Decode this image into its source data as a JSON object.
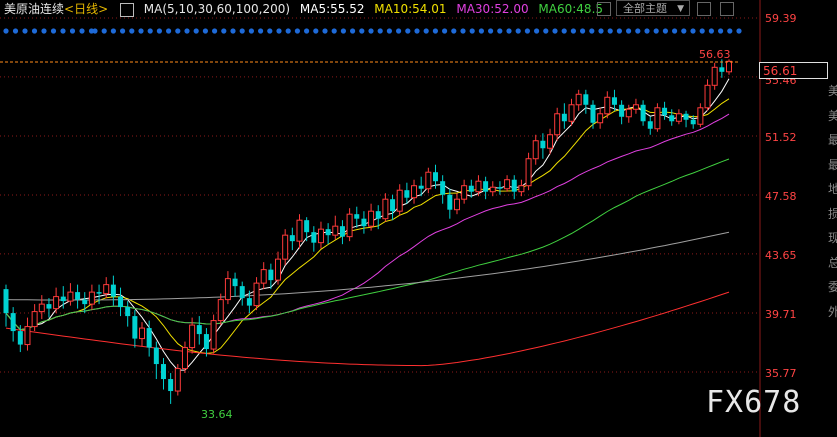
{
  "header": {
    "title": "美原油连续",
    "period": "<日线>",
    "ma_label": "MA(5,10,30,60,100,200)",
    "ma5": "MA5:55.52",
    "ma10": "MA10:54.01",
    "ma30": "MA30:52.00",
    "ma60": "MA60:48.5",
    "theme_button": "全部主题"
  },
  "price_tag": "56.61",
  "side_chars": [
    "美",
    "美",
    "最",
    "最",
    "地",
    "损",
    "现",
    "总",
    "委",
    "外"
  ],
  "watermark": "FX678",
  "colors": {
    "up": "#ff3b3b",
    "down": "#00d2d2",
    "ma5": "#ffffff",
    "ma10": "#f0e000",
    "ma30": "#e040e0",
    "ma60": "#40d040",
    "ma100": "#a0a0a0",
    "ma200": "#ff3030",
    "grid": "#8b1a1a",
    "dots": "#1e6ad8"
  },
  "chart_data": {
    "type": "candlestick",
    "y_ticks": [
      "59.39",
      "55.46",
      "51.52",
      "47.58",
      "43.65",
      "39.71",
      "35.77"
    ],
    "ylim": [
      35.77,
      59.39
    ],
    "annotations": {
      "high": "56.63",
      "low": "33.64"
    },
    "candles": [
      [
        41.3,
        39.7,
        41.6,
        38.8
      ],
      [
        39.7,
        38.5,
        40.1,
        37.8
      ],
      [
        38.5,
        37.6,
        38.9,
        37.1
      ],
      [
        37.6,
        38.8,
        39.4,
        37.2
      ],
      [
        38.8,
        39.8,
        40.3,
        38.5
      ],
      [
        39.8,
        40.3,
        40.9,
        39.3
      ],
      [
        40.3,
        40.0,
        40.7,
        39.4
      ],
      [
        40.0,
        40.8,
        41.4,
        39.7
      ],
      [
        40.8,
        40.5,
        41.5,
        40.0
      ],
      [
        40.5,
        41.1,
        41.7,
        40.2
      ],
      [
        41.1,
        40.6,
        41.6,
        40.0
      ],
      [
        40.6,
        40.3,
        41.1,
        39.7
      ],
      [
        40.3,
        41.1,
        41.6,
        39.9
      ],
      [
        41.1,
        41.0,
        41.6,
        40.3
      ],
      [
        41.0,
        41.6,
        42.1,
        40.7
      ],
      [
        41.6,
        40.8,
        42.2,
        40.2
      ],
      [
        40.8,
        40.1,
        41.4,
        39.5
      ],
      [
        40.1,
        39.5,
        40.5,
        38.8
      ],
      [
        39.5,
        38.0,
        39.9,
        37.4
      ],
      [
        38.0,
        38.7,
        39.1,
        37.5
      ],
      [
        38.7,
        37.4,
        39.2,
        36.8
      ],
      [
        37.4,
        36.3,
        37.8,
        35.3
      ],
      [
        36.3,
        35.3,
        36.7,
        34.6
      ],
      [
        35.3,
        34.5,
        35.7,
        33.64
      ],
      [
        34.5,
        36.0,
        36.3,
        34.2
      ],
      [
        36.0,
        37.4,
        37.8,
        35.7
      ],
      [
        37.4,
        38.9,
        39.4,
        37.0
      ],
      [
        38.9,
        38.3,
        39.5,
        37.6
      ],
      [
        38.3,
        37.3,
        38.7,
        36.8
      ],
      [
        37.3,
        39.2,
        39.6,
        37.0
      ],
      [
        39.2,
        40.6,
        41.0,
        38.9
      ],
      [
        40.6,
        42.0,
        42.5,
        40.3
      ],
      [
        42.0,
        41.5,
        42.4,
        40.8
      ],
      [
        41.5,
        40.7,
        41.8,
        40.2
      ],
      [
        40.7,
        40.2,
        41.2,
        39.7
      ],
      [
        40.2,
        41.7,
        42.1,
        39.9
      ],
      [
        41.7,
        42.6,
        43.1,
        41.3
      ],
      [
        42.6,
        41.9,
        43.0,
        41.3
      ],
      [
        41.9,
        43.3,
        43.8,
        41.6
      ],
      [
        43.3,
        44.9,
        45.3,
        42.9
      ],
      [
        44.9,
        44.5,
        45.4,
        43.9
      ],
      [
        44.5,
        45.9,
        46.3,
        44.0
      ],
      [
        45.9,
        45.1,
        46.1,
        44.5
      ],
      [
        45.1,
        44.4,
        45.5,
        43.8
      ],
      [
        44.4,
        45.3,
        45.8,
        44.0
      ],
      [
        45.3,
        44.9,
        45.7,
        44.3
      ],
      [
        44.9,
        45.5,
        46.2,
        44.6
      ],
      [
        45.5,
        44.8,
        45.9,
        44.3
      ],
      [
        44.8,
        46.3,
        46.7,
        44.5
      ],
      [
        46.3,
        46.0,
        46.8,
        45.4
      ],
      [
        46.0,
        45.5,
        46.5,
        45.0
      ],
      [
        45.5,
        46.5,
        47.0,
        45.2
      ],
      [
        46.5,
        46.0,
        46.9,
        45.3
      ],
      [
        46.0,
        47.3,
        47.7,
        45.8
      ],
      [
        47.3,
        46.5,
        47.6,
        45.9
      ],
      [
        46.5,
        47.9,
        48.3,
        46.2
      ],
      [
        47.9,
        47.4,
        48.4,
        47.0
      ],
      [
        47.4,
        48.2,
        48.6,
        47.0
      ],
      [
        48.2,
        48.0,
        48.8,
        47.5
      ],
      [
        48.0,
        49.1,
        49.4,
        47.7
      ],
      [
        49.1,
        48.5,
        49.6,
        48.0
      ],
      [
        48.5,
        47.6,
        48.9,
        47.0
      ],
      [
        47.6,
        46.6,
        48.0,
        46.0
      ],
      [
        46.6,
        47.3,
        47.7,
        46.3
      ],
      [
        47.3,
        48.2,
        48.6,
        47.0
      ],
      [
        48.2,
        47.8,
        48.6,
        47.4
      ],
      [
        47.8,
        48.5,
        48.9,
        47.5
      ],
      [
        48.5,
        47.8,
        48.8,
        47.3
      ],
      [
        47.8,
        48.1,
        48.5,
        47.5
      ],
      [
        48.1,
        48.0,
        48.5,
        47.6
      ],
      [
        48.0,
        48.6,
        48.9,
        47.8
      ],
      [
        48.6,
        47.8,
        48.9,
        47.3
      ],
      [
        47.8,
        48.2,
        48.6,
        47.5
      ],
      [
        48.2,
        50.0,
        50.4,
        47.9
      ],
      [
        50.0,
        51.2,
        51.6,
        49.6
      ],
      [
        51.2,
        50.7,
        51.7,
        50.0
      ],
      [
        50.7,
        51.6,
        52.0,
        50.3
      ],
      [
        51.6,
        53.0,
        53.4,
        51.2
      ],
      [
        53.0,
        52.5,
        53.7,
        52.0
      ],
      [
        52.5,
        53.6,
        54.0,
        52.2
      ],
      [
        53.6,
        54.3,
        54.6,
        53.2
      ],
      [
        54.3,
        53.6,
        54.6,
        53.0
      ],
      [
        53.6,
        52.4,
        53.9,
        52.0
      ],
      [
        52.4,
        53.0,
        53.4,
        52.0
      ],
      [
        53.0,
        54.1,
        54.5,
        52.7
      ],
      [
        54.1,
        53.6,
        54.6,
        53.2
      ],
      [
        53.6,
        52.8,
        53.9,
        52.3
      ],
      [
        52.8,
        53.3,
        53.6,
        52.4
      ],
      [
        53.3,
        53.6,
        54.0,
        53.0
      ],
      [
        53.6,
        52.5,
        53.9,
        52.2
      ],
      [
        52.5,
        52.0,
        52.8,
        51.6
      ],
      [
        52.0,
        53.4,
        53.7,
        51.8
      ],
      [
        53.4,
        52.9,
        53.8,
        52.6
      ],
      [
        52.9,
        52.5,
        53.3,
        52.2
      ],
      [
        52.5,
        53.0,
        53.3,
        52.3
      ],
      [
        53.0,
        52.6,
        53.2,
        52.1
      ],
      [
        52.6,
        52.3,
        52.9,
        52.0
      ],
      [
        52.3,
        53.4,
        53.7,
        52.1
      ],
      [
        53.4,
        54.9,
        55.3,
        53.2
      ],
      [
        54.9,
        56.1,
        56.4,
        54.6
      ],
      [
        56.1,
        55.8,
        56.63,
        55.4
      ],
      [
        55.8,
        56.5,
        56.63,
        55.6
      ]
    ]
  }
}
